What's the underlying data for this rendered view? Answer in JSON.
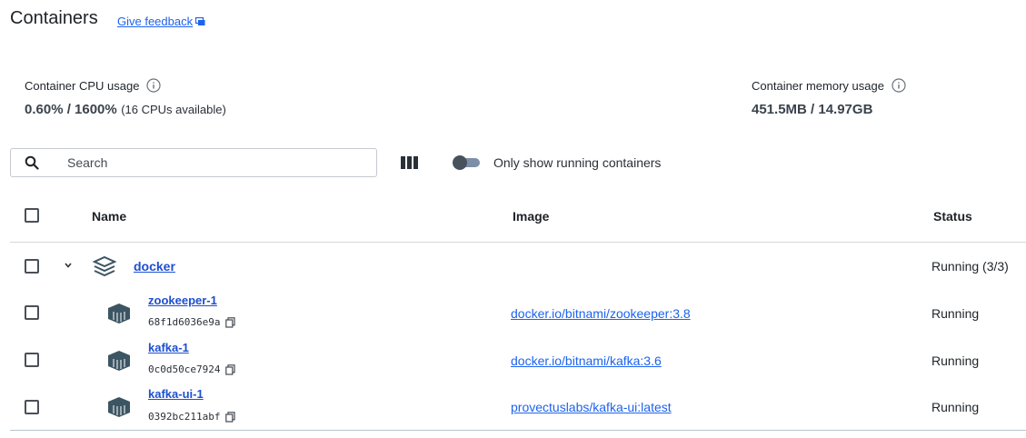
{
  "header": {
    "title": "Containers",
    "feedback_label": "Give feedback"
  },
  "metrics": {
    "cpu": {
      "label": "Container CPU usage",
      "value": "0.60% / 1600%",
      "sub": "(16 CPUs available)"
    },
    "memory": {
      "label": "Container memory usage",
      "value": "451.5MB / 14.97GB"
    }
  },
  "toolbar": {
    "search_placeholder": "Search",
    "toggle_label": "Only show running containers",
    "toggle_on": false
  },
  "table": {
    "columns": {
      "name": "Name",
      "image": "Image",
      "status": "Status"
    },
    "group": {
      "name": "docker",
      "status": "Running (3/3)"
    },
    "rows": [
      {
        "name": "zookeeper-1",
        "id": "68f1d6036e9a",
        "image": "docker.io/bitnami/zookeeper:3.8",
        "status": "Running"
      },
      {
        "name": "kafka-1",
        "id": "0c0d50ce7924",
        "image": "docker.io/bitnami/kafka:3.6",
        "status": "Running"
      },
      {
        "name": "kafka-ui-1",
        "id": "0392bc211abf",
        "image": "provectuslabs/kafka-ui:latest",
        "status": "Running"
      }
    ]
  },
  "colors": {
    "accent": "#1d63ed",
    "link_strong": "#1d4fd1",
    "icon": "#3c5563"
  },
  "icons": [
    "search-icon",
    "columns-icon",
    "info-icon",
    "feedback-icon",
    "chevron-down-icon",
    "stack-icon",
    "container-icon",
    "copy-icon"
  ]
}
